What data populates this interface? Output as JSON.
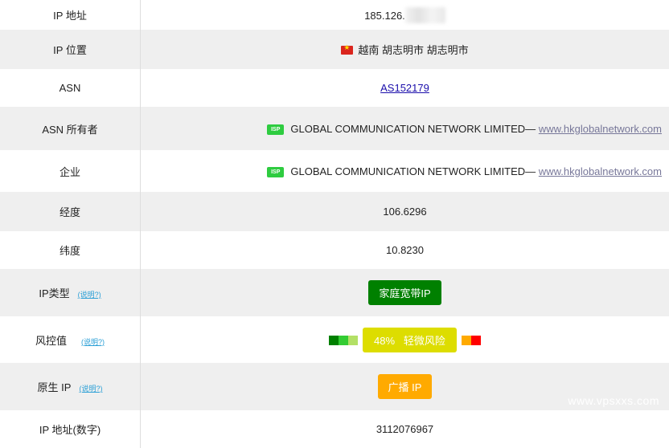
{
  "rows": {
    "ip_address": {
      "label": "IP 地址",
      "value_visible": "185.126."
    },
    "ip_location": {
      "label": "IP 位置",
      "flag_icon": "vietnam-flag-icon",
      "value": "越南 胡志明市 胡志明市"
    },
    "asn": {
      "label": "ASN",
      "value": "AS152179"
    },
    "asn_owner": {
      "label": "ASN 所有者",
      "badge": "ISP",
      "name": "GLOBAL COMMUNICATION NETWORK LIMITED—",
      "link": "www.hkglobalnetwork.com"
    },
    "company": {
      "label": "企业",
      "badge": "ISP",
      "name": "GLOBAL COMMUNICATION NETWORK LIMITED—",
      "link": "www.hkglobalnetwork.com"
    },
    "longitude": {
      "label": "经度",
      "value": "106.6296"
    },
    "latitude": {
      "label": "纬度",
      "value": "10.8230"
    },
    "ip_type": {
      "label": "IP类型",
      "help": "(说明?)",
      "value": "家庭宽带IP"
    },
    "risk": {
      "label": "风控值",
      "help": "(说明?)",
      "percent": "48%",
      "level": "轻微风险",
      "risk_value": 48,
      "scale_colors": [
        "#008000",
        "#33cc33",
        "#b3e066",
        "#ffaa00",
        "#ff0000"
      ]
    },
    "native_ip": {
      "label": "原生 IP",
      "help": "(说明?)",
      "value": "广播 IP"
    },
    "ip_numeric": {
      "label": "IP 地址(数字)",
      "value": "3112076967"
    }
  },
  "watermark": "www.vpsxxs.com",
  "colors": {
    "ip_type_badge": "#008000",
    "risk_badge": "#dddd00",
    "native_badge": "#ffaa00",
    "isp_badge": "#2ecc40"
  }
}
